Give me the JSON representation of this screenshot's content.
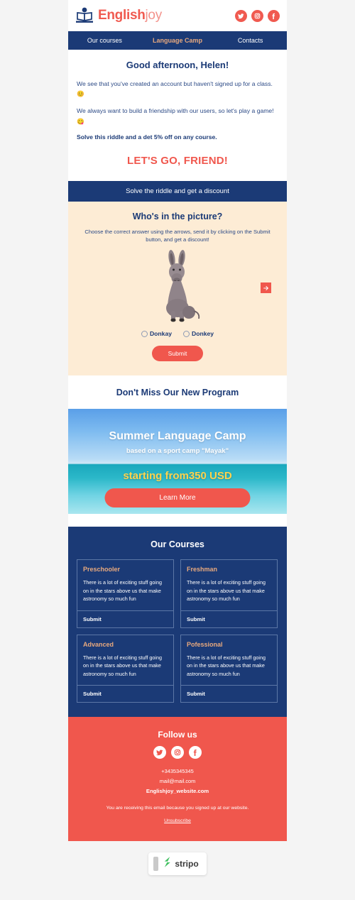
{
  "header": {
    "brand_primary": "English",
    "brand_secondary": "joy",
    "logo_icon": "person-reading-book-icon",
    "socials": [
      {
        "name": "twitter-icon",
        "label": "Twitter"
      },
      {
        "name": "instagram-icon",
        "label": "Instagram"
      },
      {
        "name": "facebook-icon",
        "label": "Facebook"
      }
    ]
  },
  "nav": {
    "items": [
      {
        "label": "Our courses",
        "active": false
      },
      {
        "label": "Language Camp",
        "active": true
      },
      {
        "label": "Contacts",
        "active": false
      }
    ]
  },
  "greeting": {
    "title": "Good afternoon, Helen!",
    "paragraph1": "We see that you've created an account but haven't signed up for a class. 😊",
    "paragraph2": "We always want to build a friendship with our users, so let's play a game!😋",
    "offer": "Solve this riddle and a det 5% off on any course.",
    "cta": "LET'S GO, FRIEND!"
  },
  "riddle": {
    "bar_label": "Solve the riddle and get a discount",
    "title": "Who's in the picture?",
    "instructions": "Choose the correct answer using the arrows, send it by clicking on the Submit button, and get a discount!",
    "image_alt": "donkey-photo",
    "next_arrow_icon": "arrow-right-icon",
    "options": [
      {
        "label": "Donkay",
        "selected": false
      },
      {
        "label": "Donkey",
        "selected": false
      }
    ],
    "submit_label": "Submit"
  },
  "program": {
    "section_title": "Don't Miss Our New Program",
    "camp_title": "Summer Language Camp",
    "camp_subtitle": "based on a sport camp \"Mayak\"",
    "camp_price": "starting from350 USD",
    "camp_button": "Learn More"
  },
  "courses": {
    "title": "Our Courses",
    "cards": [
      {
        "title": "Preschooler",
        "text": "There is a lot of exciting stuff going on in the stars above us that make astronomy so much fun",
        "action": "Submit"
      },
      {
        "title": "Freshman",
        "text": "There is a lot of exciting stuff going on in the stars above us that make astronomy so much fun",
        "action": "Submit"
      },
      {
        "title": "Advanced",
        "text": "There is a lot of exciting stuff going on in the stars above us that make astronomy so much fun",
        "action": "Submit"
      },
      {
        "title": "Pofessional",
        "text": "There is a lot of exciting stuff going on in the stars above us that make astronomy so much fun",
        "action": "Submit"
      }
    ]
  },
  "footer": {
    "follow_title": "Follow us",
    "socials": [
      {
        "name": "twitter-icon",
        "label": "Twitter"
      },
      {
        "name": "instagram-icon",
        "label": "Instagram"
      },
      {
        "name": "facebook-icon",
        "label": "Facebook"
      }
    ],
    "phone": "+3435345345",
    "email": "mail@mail.com",
    "website": "Englishjoy_website.com",
    "legal": "You are receiving this email because you signed up at our website.",
    "unsubscribe": "Unsubscribe"
  },
  "branding": {
    "stripo_name": "stripo",
    "stripo_icon": "stripo-logo-icon"
  },
  "colors": {
    "navy": "#1b3a76",
    "red": "#f0574d",
    "beige": "#fdecd5",
    "tan": "#e8a97e",
    "yellow": "#ffd34d",
    "page_bg": "#f4f4f4"
  }
}
